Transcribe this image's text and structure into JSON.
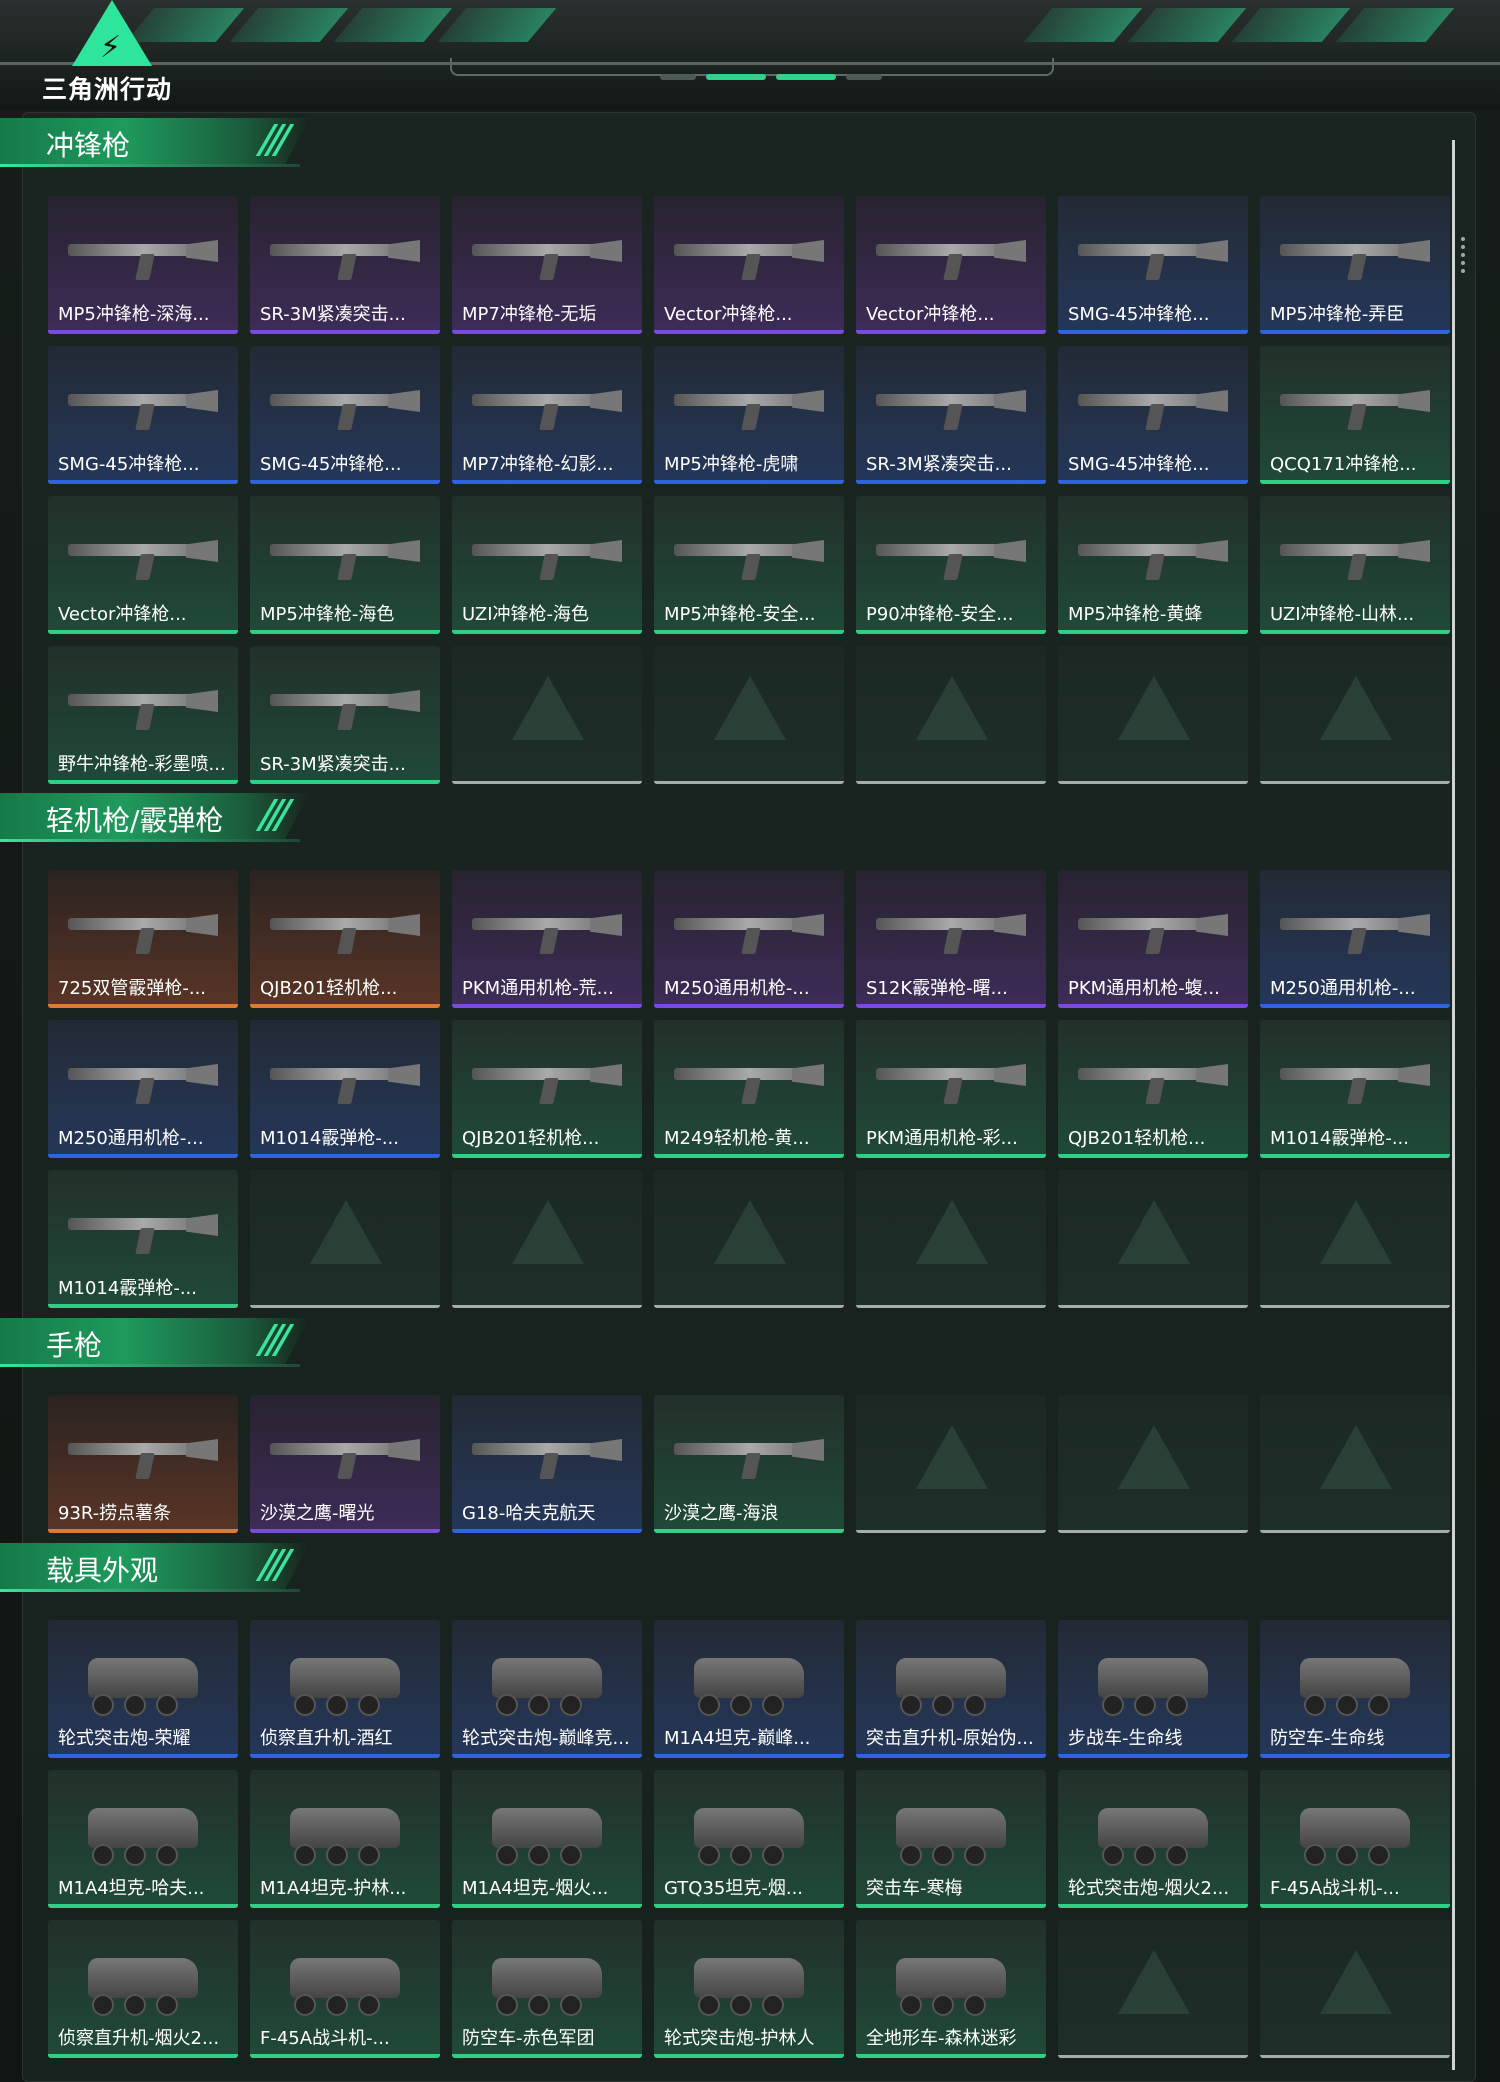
{
  "app": {
    "logo_text": "三角洲行动"
  },
  "colors": {
    "gold": "#e07a2e",
    "purple": "#7b4ae0",
    "blue": "#2f63e0",
    "green": "#2fcf86",
    "accent": "#2ee59c"
  },
  "sections": [
    {
      "title": "冲锋枪",
      "items": [
        {
          "name": "MP5冲锋枪-深海...",
          "rarity": "purple",
          "kind": "gun"
        },
        {
          "name": "SR-3M紧凑突击...",
          "rarity": "purple",
          "kind": "gun"
        },
        {
          "name": "MP7冲锋枪-无垢",
          "rarity": "purple",
          "kind": "gun"
        },
        {
          "name": "Vector冲锋枪...",
          "rarity": "purple",
          "kind": "gun"
        },
        {
          "name": "Vector冲锋枪...",
          "rarity": "purple",
          "kind": "gun"
        },
        {
          "name": "SMG-45冲锋枪...",
          "rarity": "blue",
          "kind": "gun"
        },
        {
          "name": "MP5冲锋枪-弄臣",
          "rarity": "blue",
          "kind": "gun"
        },
        {
          "name": "SMG-45冲锋枪...",
          "rarity": "blue",
          "kind": "gun"
        },
        {
          "name": "SMG-45冲锋枪...",
          "rarity": "blue",
          "kind": "gun"
        },
        {
          "name": "MP7冲锋枪-幻影...",
          "rarity": "blue",
          "kind": "gun"
        },
        {
          "name": "MP5冲锋枪-虎啸",
          "rarity": "blue",
          "kind": "gun"
        },
        {
          "name": "SR-3M紧凑突击...",
          "rarity": "blue",
          "kind": "gun"
        },
        {
          "name": "SMG-45冲锋枪...",
          "rarity": "blue",
          "kind": "gun"
        },
        {
          "name": "QCQ171冲锋枪...",
          "rarity": "green",
          "kind": "gun"
        },
        {
          "name": "Vector冲锋枪...",
          "rarity": "green",
          "kind": "gun"
        },
        {
          "name": "MP5冲锋枪-海色",
          "rarity": "green",
          "kind": "gun"
        },
        {
          "name": "UZI冲锋枪-海色",
          "rarity": "green",
          "kind": "gun"
        },
        {
          "name": "MP5冲锋枪-安全...",
          "rarity": "green",
          "kind": "gun"
        },
        {
          "name": "P90冲锋枪-安全...",
          "rarity": "green",
          "kind": "gun"
        },
        {
          "name": "MP5冲锋枪-黄蜂",
          "rarity": "green",
          "kind": "gun"
        },
        {
          "name": "UZI冲锋枪-山林...",
          "rarity": "green",
          "kind": "gun"
        },
        {
          "name": "野牛冲锋枪-彩墨喷...",
          "rarity": "green",
          "kind": "gun"
        },
        {
          "name": "SR-3M紧凑突击...",
          "rarity": "green",
          "kind": "gun"
        },
        {
          "name": "",
          "rarity": "empty",
          "kind": "empty"
        },
        {
          "name": "",
          "rarity": "empty",
          "kind": "empty"
        },
        {
          "name": "",
          "rarity": "empty",
          "kind": "empty"
        },
        {
          "name": "",
          "rarity": "empty",
          "kind": "empty"
        },
        {
          "name": "",
          "rarity": "empty",
          "kind": "empty"
        }
      ]
    },
    {
      "title": "轻机枪/霰弹枪",
      "items": [
        {
          "name": "725双管霰弹枪-...",
          "rarity": "gold",
          "kind": "gun"
        },
        {
          "name": "QJB201轻机枪...",
          "rarity": "gold",
          "kind": "gun"
        },
        {
          "name": "PKM通用机枪-荒...",
          "rarity": "purple",
          "kind": "gun"
        },
        {
          "name": "M250通用机枪-...",
          "rarity": "purple",
          "kind": "gun"
        },
        {
          "name": "S12K霰弹枪-曙...",
          "rarity": "purple",
          "kind": "gun"
        },
        {
          "name": "PKM通用机枪-蝮...",
          "rarity": "purple",
          "kind": "gun"
        },
        {
          "name": "M250通用机枪-...",
          "rarity": "blue",
          "kind": "gun"
        },
        {
          "name": "M250通用机枪-...",
          "rarity": "blue",
          "kind": "gun"
        },
        {
          "name": "M1014霰弹枪-...",
          "rarity": "blue",
          "kind": "gun"
        },
        {
          "name": "QJB201轻机枪...",
          "rarity": "green",
          "kind": "gun"
        },
        {
          "name": "M249轻机枪-黄...",
          "rarity": "green",
          "kind": "gun"
        },
        {
          "name": "PKM通用机枪-彩...",
          "rarity": "green",
          "kind": "gun"
        },
        {
          "name": "QJB201轻机枪...",
          "rarity": "green",
          "kind": "gun"
        },
        {
          "name": "M1014霰弹枪-...",
          "rarity": "green",
          "kind": "gun"
        },
        {
          "name": "M1014霰弹枪-...",
          "rarity": "green",
          "kind": "gun"
        },
        {
          "name": "",
          "rarity": "empty",
          "kind": "empty"
        },
        {
          "name": "",
          "rarity": "empty",
          "kind": "empty"
        },
        {
          "name": "",
          "rarity": "empty",
          "kind": "empty"
        },
        {
          "name": "",
          "rarity": "empty",
          "kind": "empty"
        },
        {
          "name": "",
          "rarity": "empty",
          "kind": "empty"
        },
        {
          "name": "",
          "rarity": "empty",
          "kind": "empty"
        }
      ]
    },
    {
      "title": "手枪",
      "items": [
        {
          "name": "93R-捞点薯条",
          "rarity": "gold",
          "kind": "gun"
        },
        {
          "name": "沙漠之鹰-曙光",
          "rarity": "purple",
          "kind": "gun"
        },
        {
          "name": "G18-哈夫克航天",
          "rarity": "blue",
          "kind": "gun"
        },
        {
          "name": "沙漠之鹰-海浪",
          "rarity": "green",
          "kind": "gun"
        },
        {
          "name": "",
          "rarity": "empty",
          "kind": "empty"
        },
        {
          "name": "",
          "rarity": "empty",
          "kind": "empty"
        },
        {
          "name": "",
          "rarity": "empty",
          "kind": "empty"
        }
      ]
    },
    {
      "title": "载具外观",
      "items": [
        {
          "name": "轮式突击炮-荣耀",
          "rarity": "blue",
          "kind": "vehicle"
        },
        {
          "name": "侦察直升机-酒红",
          "rarity": "blue",
          "kind": "vehicle"
        },
        {
          "name": "轮式突击炮-巅峰竞...",
          "rarity": "blue",
          "kind": "vehicle"
        },
        {
          "name": "M1A4坦克-巅峰...",
          "rarity": "blue",
          "kind": "vehicle"
        },
        {
          "name": "突击直升机-原始伪...",
          "rarity": "blue",
          "kind": "vehicle"
        },
        {
          "name": "步战车-生命线",
          "rarity": "blue",
          "kind": "vehicle"
        },
        {
          "name": "防空车-生命线",
          "rarity": "blue",
          "kind": "vehicle"
        },
        {
          "name": "M1A4坦克-哈夫...",
          "rarity": "green",
          "kind": "vehicle"
        },
        {
          "name": "M1A4坦克-护林...",
          "rarity": "green",
          "kind": "vehicle"
        },
        {
          "name": "M1A4坦克-烟火...",
          "rarity": "green",
          "kind": "vehicle"
        },
        {
          "name": "GTQ35坦克-烟...",
          "rarity": "green",
          "kind": "vehicle"
        },
        {
          "name": "突击车-寒梅",
          "rarity": "green",
          "kind": "vehicle"
        },
        {
          "name": "轮式突击炮-烟火2...",
          "rarity": "green",
          "kind": "vehicle"
        },
        {
          "name": "F-45A战斗机-...",
          "rarity": "green",
          "kind": "vehicle"
        },
        {
          "name": "侦察直升机-烟火2...",
          "rarity": "green",
          "kind": "vehicle"
        },
        {
          "name": "F-45A战斗机-...",
          "rarity": "green",
          "kind": "vehicle"
        },
        {
          "name": "防空车-赤色军团",
          "rarity": "green",
          "kind": "vehicle"
        },
        {
          "name": "轮式突击炮-护林人",
          "rarity": "green",
          "kind": "vehicle"
        },
        {
          "name": "全地形车-森林迷彩",
          "rarity": "green",
          "kind": "vehicle"
        },
        {
          "name": "",
          "rarity": "empty",
          "kind": "empty"
        },
        {
          "name": "",
          "rarity": "empty",
          "kind": "empty"
        }
      ]
    }
  ]
}
